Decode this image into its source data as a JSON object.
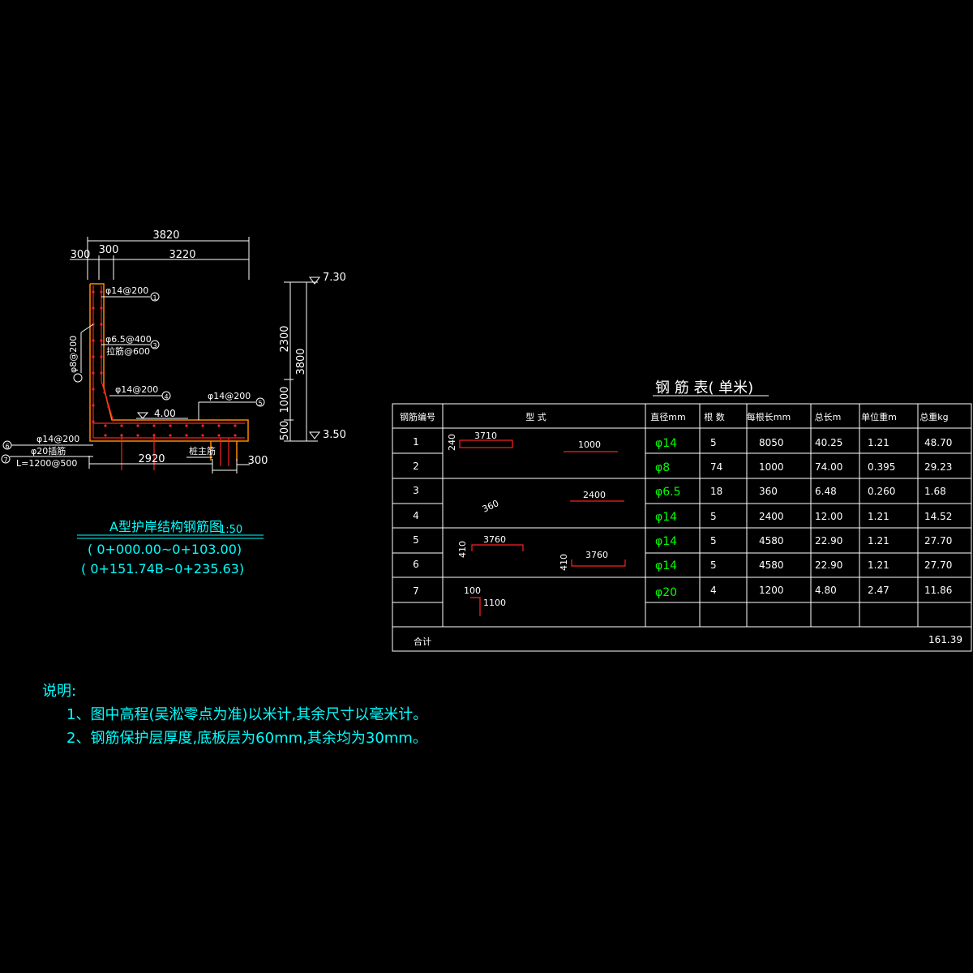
{
  "drawing": {
    "dims": {
      "total_width": "3820",
      "d300_left": "300",
      "d300_inner": "300",
      "d3220": "3220",
      "d2920": "2920",
      "d300_right": "300",
      "h2300": "2300",
      "h3800": "3800",
      "h1000": "1000",
      "h500": "500"
    },
    "elevations": {
      "top": "7.30",
      "bottom": "3.50",
      "slab": "4.00"
    },
    "rebar_labels": {
      "r1": "φ14@200",
      "r2": "φ6.5@400",
      "r3": "拉筋@600",
      "r4": "φ8@200",
      "r5": "φ14@200",
      "r6": "φ14@200",
      "r7": "φ14@200",
      "r8": "φ20插筋",
      "r9": "L=1200@500",
      "pile": "桩主筋"
    },
    "markers": [
      "1",
      "3",
      "4",
      "5",
      "6",
      "7"
    ],
    "title": "A型护岸结构钢筋图",
    "scale": "1:50",
    "range1": "( 0+000.00~0+103.00)",
    "range2": "( 0+151.74B~0+235.63)"
  },
  "table": {
    "title": "钢 筋 表( 单米)",
    "headers": [
      "钢筋编号",
      "型    式",
      "直径mm",
      "根 数",
      "每根长mm",
      "总长m",
      "单位重m",
      "总重kg"
    ],
    "rows": [
      {
        "no": "1",
        "dia": "φ14",
        "count": "5",
        "len": "8050",
        "total": "40.25",
        "unit": "1.21",
        "weight": "48.70"
      },
      {
        "no": "2",
        "dia": "φ8",
        "count": "74",
        "len": "1000",
        "total": "74.00",
        "unit": "0.395",
        "weight": "29.23"
      },
      {
        "no": "3",
        "dia": "φ6.5",
        "count": "18",
        "len": "360",
        "total": "6.48",
        "unit": "0.260",
        "weight": "1.68"
      },
      {
        "no": "4",
        "dia": "φ14",
        "count": "5",
        "len": "2400",
        "total": "12.00",
        "unit": "1.21",
        "weight": "14.52"
      },
      {
        "no": "5",
        "dia": "φ14",
        "count": "5",
        "len": "4580",
        "total": "22.90",
        "unit": "1.21",
        "weight": "27.70"
      },
      {
        "no": "6",
        "dia": "φ14",
        "count": "5",
        "len": "4580",
        "total": "22.90",
        "unit": "1.21",
        "weight": "27.70"
      },
      {
        "no": "7",
        "dia": "φ20",
        "count": "4",
        "len": "1200",
        "total": "4.80",
        "unit": "2.47",
        "weight": "11.86"
      }
    ],
    "shape_labels": {
      "s1a": "240",
      "s1b": "3710",
      "s1c": "1000",
      "s3a": "360",
      "s3b": "2400",
      "s5a": "410",
      "s5b": "3760",
      "s6a": "410",
      "s6b": "3760",
      "s7a": "100",
      "s7b": "1100"
    },
    "sum_label": "合计",
    "sum_value": "161.39"
  },
  "notes": {
    "heading": "说明:",
    "item1": "1、图中高程(吴淞零点为准)以米计,其余尺寸以毫米计。",
    "item2": "2、钢筋保护层厚度,底板层为60mm,其余均为30mm。"
  },
  "colors": {
    "background": "#000000",
    "lines": "#ffffff",
    "dimension_text": "#00ffff",
    "rebar": "#ff2020",
    "concrete_outline": "#ff8800",
    "diameter_text": "#00ff00"
  }
}
